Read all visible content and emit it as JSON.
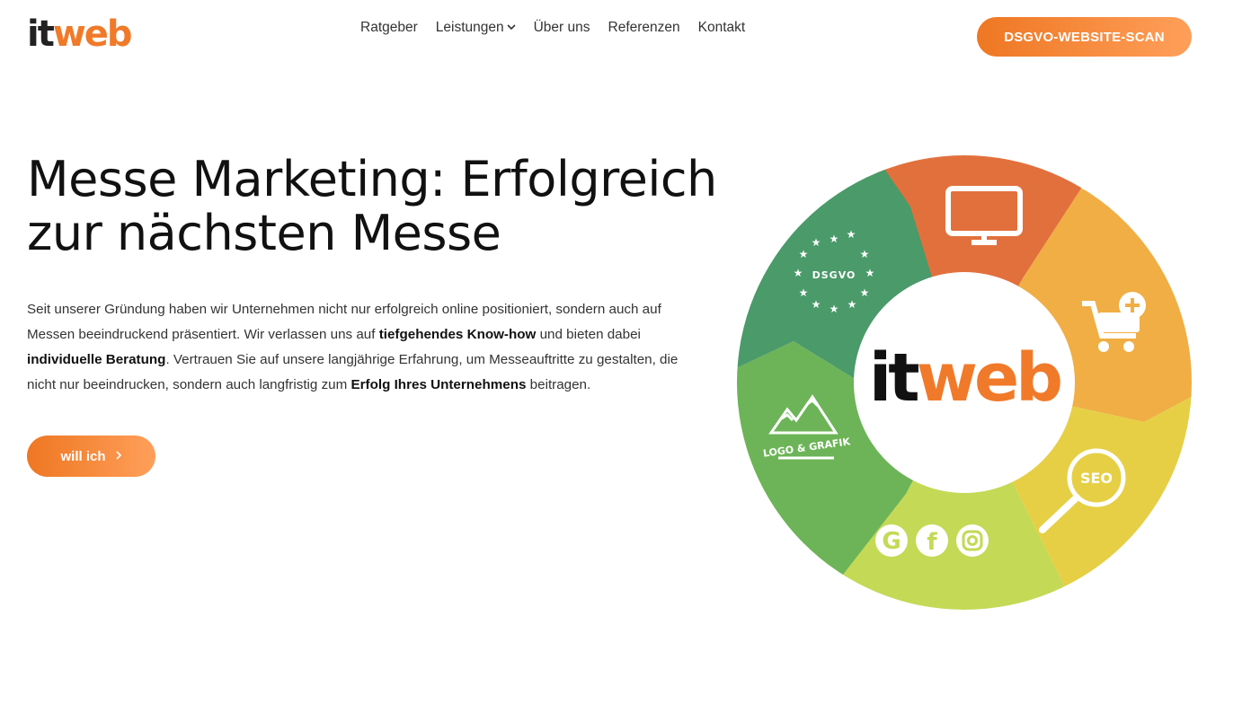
{
  "header": {
    "logo_it": "it",
    "logo_web": "web",
    "nav": [
      {
        "label": "Ratgeber"
      },
      {
        "label": "Leistungen"
      },
      {
        "label": "Über uns"
      },
      {
        "label": "Referenzen"
      },
      {
        "label": "Kontakt"
      }
    ],
    "cta_label": "DSGVO-WEBSITE-SCAN"
  },
  "hero": {
    "title_line1": "Messe Marketing: Erfolgreich",
    "title_line2": "zur nächsten Messe",
    "para": {
      "t1": "Seit unserer Gründung haben wir Unternehmen nicht nur erfolgreich online positioniert, sondern auch auf Messen beeindruckend präsentiert. Wir verlassen uns auf ",
      "b1": "tiefgehendes Know-how",
      "t2": " und bieten dabei ",
      "b2": "individuelle Beratung",
      "t3": ". Vertrauen Sie auf unsere langjährige Erfahrung, um Messeauftritte zu gestalten, die nicht nur beeindrucken, sondern auch langfristig zum ",
      "b3": "Erfolg Ihres Unternehmens",
      "t4": " beitragen."
    },
    "cta_label": "will ich",
    "cta_icon": "chevron-right-icon"
  },
  "wheel": {
    "center_it": "it",
    "center_web": "web",
    "dsgvo_label": "DSGVO",
    "seo_label": "SEO",
    "logo_grafik_label": "LOGO & GRAFIK",
    "social_g": "G",
    "social_f": "f",
    "colors": {
      "orange_top": "#e2703d",
      "orange_right": "#f0ae45",
      "yellow": "#e6cf45",
      "lime": "#c4d955",
      "green": "#6cb457",
      "dark_green": "#4a9a6a",
      "accent": "#f07a2a"
    },
    "icons": [
      "monitor-icon",
      "cart-plus-icon",
      "seo-magnifier-icon",
      "google-icon",
      "facebook-icon",
      "instagram-icon",
      "mountain-icon",
      "eu-stars-icon"
    ]
  }
}
